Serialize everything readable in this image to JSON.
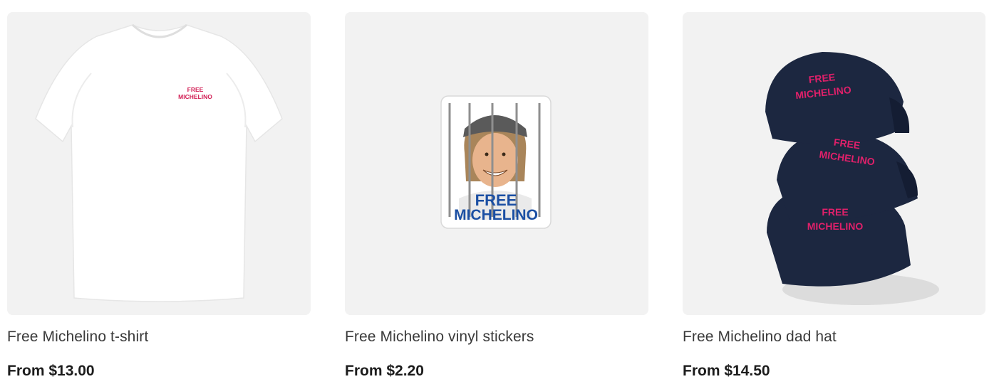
{
  "products": [
    {
      "title": "Free Michelino t-shirt",
      "price": "From $13.00",
      "print_text_line1": "FREE",
      "print_text_line2": "MICHELINO"
    },
    {
      "title": "Free Michelino vinyl stickers",
      "price": "From $2.20",
      "print_text_line1": "FREE",
      "print_text_line2": "MICHELINO"
    },
    {
      "title": "Free Michelino dad hat",
      "price": "From $14.50",
      "print_text_line1": "FREE",
      "print_text_line2": "MICHELINO"
    }
  ],
  "colors": {
    "thumb_bg": "#f2f2f2",
    "shirt_print": "#d21f55",
    "hat_navy": "#1c2740",
    "hat_print": "#e0206a",
    "sticker_text": "#1b4fa3"
  }
}
